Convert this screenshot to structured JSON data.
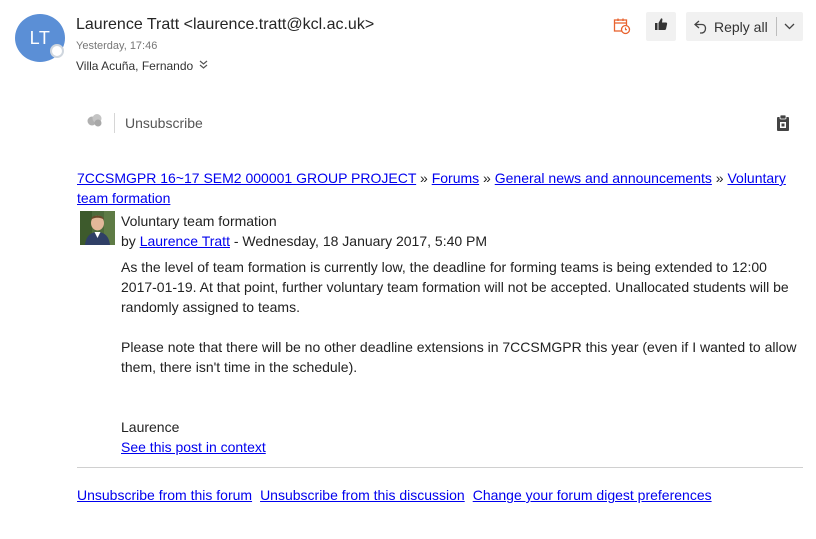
{
  "header": {
    "avatar_initials": "LT",
    "sender": "Laurence Tratt <laurence.tratt@kcl.ac.uk>",
    "timestamp": "Yesterday, 17:46",
    "recipient": "Villa Acuña, Fernando",
    "expand_icon": "double-chevron-down-icon",
    "calendar_icon": "calendar-clock-icon",
    "like_icon": "thumbs-up-icon",
    "reply_all_label": "Reply all",
    "reply_icon": "reply-all-icon",
    "dropdown_icon": "chevron-down-icon"
  },
  "unsubscribe_bar": {
    "icon": "cloud-icon",
    "label": "Unsubscribe",
    "attachment_icon": "clipboard-icon"
  },
  "breadcrumb": {
    "items": [
      "7CCSMGPR 16~17 SEM2 000001 GROUP PROJECT",
      "Forums",
      "General news and announcements",
      "Voluntary team formation"
    ],
    "separator": "»"
  },
  "post": {
    "subject": "Voluntary team formation",
    "by_prefix": "by",
    "author": "Laurence Tratt",
    "date": " - Wednesday, 18 January 2017, 5:40 PM",
    "paragraph1": "As the level of team formation is currently low, the deadline for forming teams is being extended to 12:00 2017-01-19. At that point, further voluntary team formation will not be accepted. Unallocated students will be randomly assigned to teams.",
    "paragraph2": "Please note that there will be no other deadline extensions in 7CCSMGPR this year (even if I wanted to allow them, there isn't time in the schedule).",
    "signature": "Laurence",
    "context_link": "See this post in context"
  },
  "footer": {
    "links": [
      "Unsubscribe from this forum",
      "Unsubscribe from this discussion",
      "Change your forum digest preferences"
    ]
  },
  "colors": {
    "avatar": "#5b8fd6",
    "link": "#0000ee",
    "calendar_icon": "#e8632f"
  }
}
